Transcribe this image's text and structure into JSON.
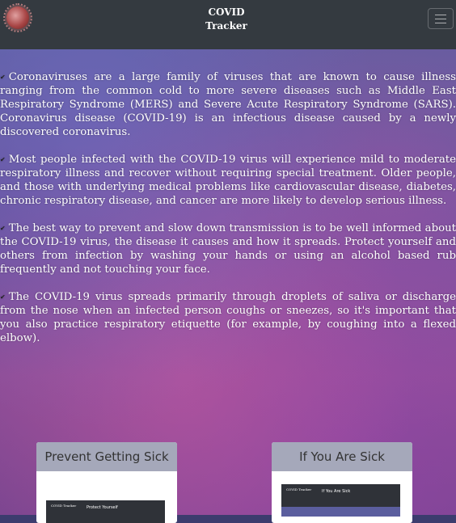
{
  "navbar": {
    "title_line1": "COVID",
    "title_line2": "Tracker",
    "logo_icon": "virus-logo-icon",
    "menu_icon": "hamburger-menu-icon"
  },
  "paragraphs": [
    "Coronaviruses are a large family of viruses that are known to cause illness ranging from the common cold to more severe diseases such as Middle East Respiratory Syndrome (MERS) and Severe Acute Respiratory Syndrome (SARS). Coronavirus disease (COVID-19) is an infectious disease caused by a newly discovered coronavirus.",
    "Most people infected with the COVID-19 virus will experience mild to moderate respiratory illness and recover without requiring special treatment. Older people, and those with underlying medical problems like cardiovascular disease, diabetes, chronic respiratory disease, and cancer are more likely to develop serious illness.",
    "The best way to prevent and slow down transmission is to be well informed about the COVID-19 virus, the disease it causes and how it spreads. Protect yourself and others from infection by washing your hands or using an alcohol based rub frequently and not touching your face.",
    "The COVID-19 virus spreads primarily through droplets of saliva or discharge from the nose when an infected person coughs or sneezes, so it's important that you also practice respiratory etiquette (for example, by coughing into a flexed elbow)."
  ],
  "cards": [
    {
      "title": "Prevent Getting Sick",
      "thumb_title": "Protect Yourself",
      "thumb_brand": "COVID Tracker"
    },
    {
      "title": "If You Are Sick",
      "thumb_title": "If You Are Sick",
      "thumb_brand": "COVID Tracker"
    }
  ],
  "colors": {
    "navbar": "#343a40",
    "card_header": "#a5a8ba"
  }
}
